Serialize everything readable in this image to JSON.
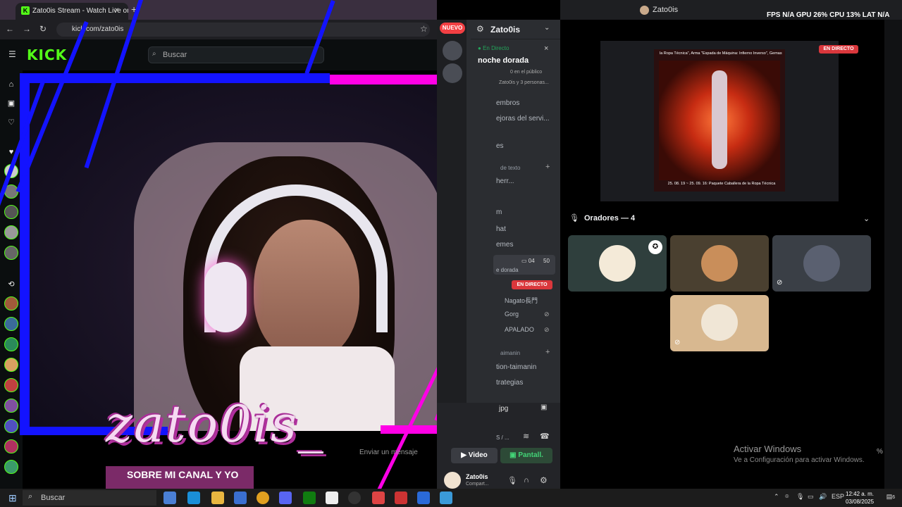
{
  "browser": {
    "tab_title": "Zato0is Stream - Watch Live on",
    "tab_close": "×",
    "new_tab": "+",
    "url": "kick.com/zato0is"
  },
  "kick": {
    "logo": "KICK",
    "search_placeholder": "Buscar",
    "chat_placeholder": "Enviar un mensaje",
    "banner": "SOBRE MI CANAL Y YO",
    "overlay_name": "zato0is_"
  },
  "discord": {
    "nuevo": "NUEVO",
    "server_name": "Zato0is",
    "event": {
      "status": "En Directo",
      "title": "noche dorada",
      "audience": "0 en el público",
      "participants": "Zato0is y 3 personas..."
    },
    "channels": [
      {
        "label": "embros"
      },
      {
        "label": "ejoras del servi..."
      },
      {
        "label": "es"
      },
      {
        "label": "herr..."
      },
      {
        "label": "m"
      },
      {
        "label": "hat"
      },
      {
        "label": "emes"
      }
    ],
    "category_text": "de texto",
    "voice_channel": {
      "count_video": "04",
      "count_limit": "50",
      "subtitle": "e dorada",
      "live_badge": "EN DIRECTO",
      "users": [
        "Nagato長門",
        "Gorg",
        "APALADO"
      ]
    },
    "category_taimanin": "aimanin",
    "channel_taimanin": "tion-taimanin",
    "channel_estrategias": "trategias",
    "attachment": "jpg",
    "voice_status": "S / ...",
    "video_btn": "Video",
    "screen_btn": "Pantall.",
    "user": {
      "name": "Zato0is",
      "status": "Compart..."
    }
  },
  "stage": {
    "window_title": "Zato0is",
    "stats": "FPS N/A GPU 26% CPU 13% LAT N/A",
    "screen_caption_top": "la Ropa Técnica\", Arma \"Espada de Máquina: Infierno Inverso\", Gemas",
    "screen_caption_bottom": "25. 08. 19 ~ 25. 09. 16: Paquete Caballera de la Ropa Técnica",
    "en_directo": "EN DIRECTO",
    "speakers_label": "Oradores — 4",
    "speakers": [
      {
        "color": "#2f3f3d"
      },
      {
        "color": "#4a4030"
      },
      {
        "color": "#3a3f46"
      },
      {
        "color": "#d8b890"
      }
    ],
    "pct": "%"
  },
  "windows": {
    "activate_title": "Activar Windows",
    "activate_sub": "Ve a Configuración para activar Windows.",
    "search": "Buscar",
    "lang": "ESP",
    "time": "12:42 a. m.",
    "date": "03/08/2025",
    "notif": "6"
  },
  "colors": {
    "kick_green": "#53fc18",
    "frame_blue": "#1313ff",
    "frame_pink": "#ff00e6",
    "discord_bg": "#2b2d31",
    "live_red": "#da373c"
  }
}
